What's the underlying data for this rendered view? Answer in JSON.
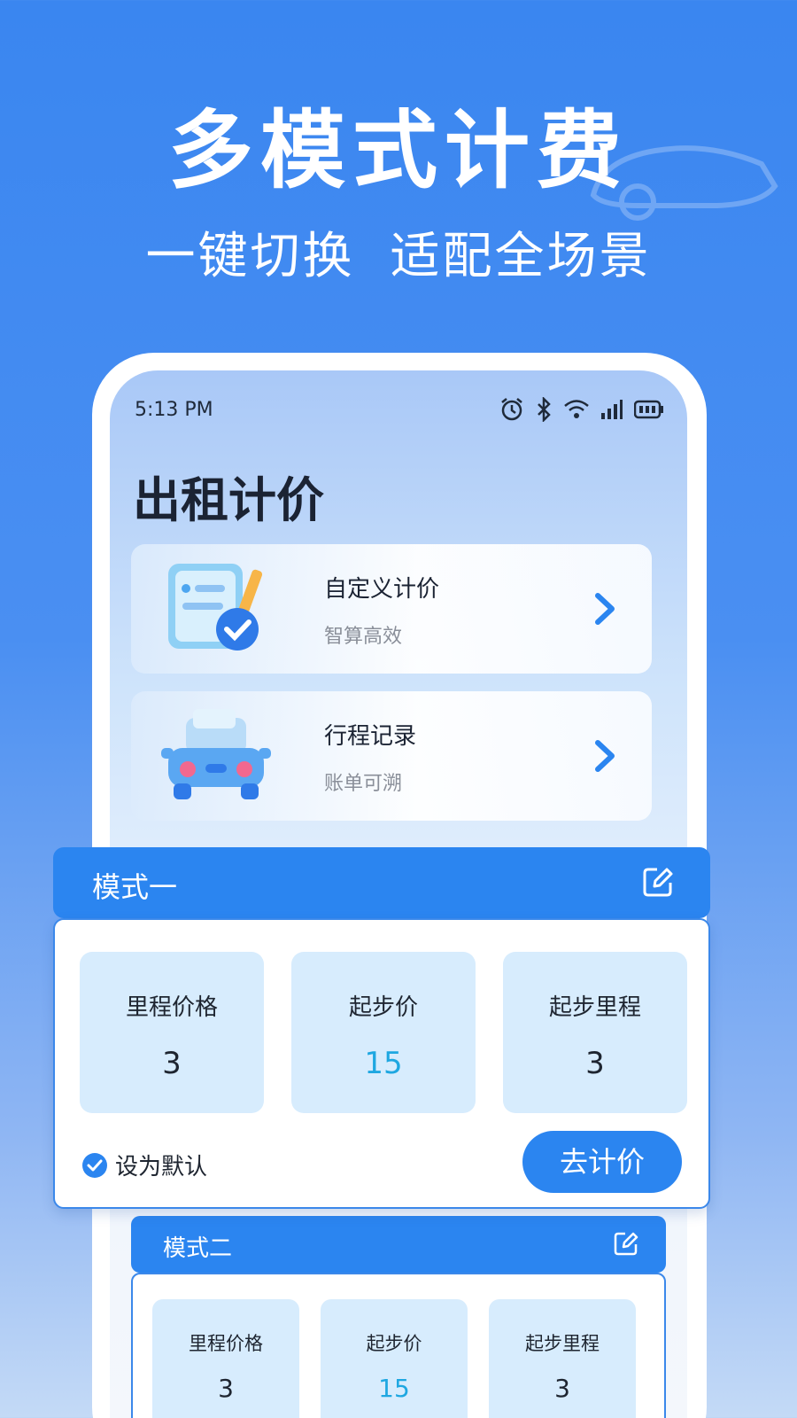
{
  "promo": {
    "headline": "多模式计费",
    "subline_left": "一键切换",
    "subline_right": "适配全场景"
  },
  "status_bar": {
    "time": "5:13 PM",
    "icons": [
      "alarm-icon",
      "bluetooth-icon",
      "wifi-icon",
      "signal-icon",
      "battery-icon"
    ]
  },
  "page": {
    "title": "出租计价"
  },
  "menu": [
    {
      "title": "自定义计价",
      "subtitle": "智算高效",
      "icon": "document-pencil-icon"
    },
    {
      "title": "行程记录",
      "subtitle": "账单可溯",
      "icon": "car-icon"
    }
  ],
  "modes": [
    {
      "label": "模式一",
      "fields": [
        {
          "label": "里程价格",
          "value": "3"
        },
        {
          "label": "起步价",
          "value": "15"
        },
        {
          "label": "起步里程",
          "value": "3"
        }
      ],
      "default_label": "设为默认",
      "default_checked": true,
      "action_label": "去计价"
    },
    {
      "label": "模式二",
      "fields": [
        {
          "label": "里程价格",
          "value": "3"
        },
        {
          "label": "起步价",
          "value": "15"
        },
        {
          "label": "起步里程",
          "value": "3"
        }
      ]
    }
  ],
  "colors": {
    "primary": "#2b85f0",
    "accent_value": "#1ea7e1",
    "tile_bg": "#d7ecfd",
    "title_text": "#1b2333"
  }
}
